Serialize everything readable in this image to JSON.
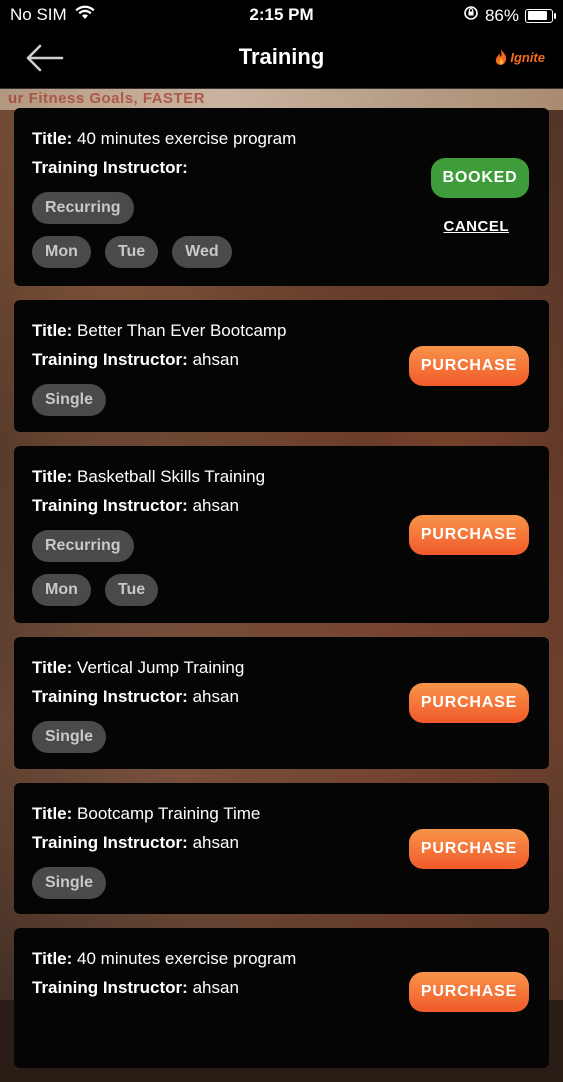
{
  "status_bar": {
    "carrier": "No SIM",
    "time": "2:15 PM",
    "battery": "86%"
  },
  "nav": {
    "title": "Training",
    "logo_text": "Ignite"
  },
  "background": {
    "banner_text": "ur Fitness Goals, FASTER"
  },
  "labels": {
    "title": "Title:",
    "instructor": "Training Instructor:"
  },
  "cards": [
    {
      "title": "40 minutes exercise program",
      "instructor": "",
      "type": "Recurring",
      "days": [
        "Mon",
        "Tue",
        "Wed"
      ],
      "action": "BOOKED",
      "secondary": "CANCEL"
    },
    {
      "title": "Better Than Ever Bootcamp",
      "instructor": "ahsan",
      "type": "Single",
      "days": [],
      "action": "PURCHASE"
    },
    {
      "title": "Basketball Skills Training",
      "instructor": "ahsan",
      "type": "Recurring",
      "days": [
        "Mon",
        "Tue"
      ],
      "action": "PURCHASE"
    },
    {
      "title": "Vertical Jump Training",
      "instructor": "ahsan",
      "type": "Single",
      "days": [],
      "action": "PURCHASE"
    },
    {
      "title": "Bootcamp Training Time",
      "instructor": "ahsan",
      "type": "Single",
      "days": [],
      "action": "PURCHASE"
    },
    {
      "title": "40 minutes exercise program",
      "instructor": "ahsan",
      "type": "",
      "days": [],
      "action": "PURCHASE"
    }
  ],
  "colors": {
    "booked": "#3f9c3a",
    "purchase_top": "#f7944a",
    "purchase_bottom": "#f15a2a",
    "pill_bg": "#4a4a4a"
  }
}
